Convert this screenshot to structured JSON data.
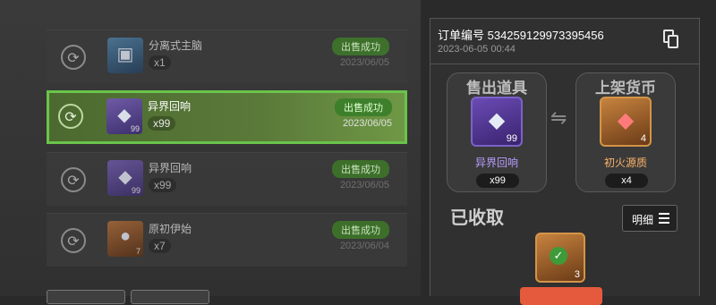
{
  "orders": [
    {
      "name": "分离式主脑",
      "count": "x1",
      "status": "出售成功",
      "date": "2023/06/05",
      "qty": "",
      "icon": "device-icon"
    },
    {
      "name": "异界回响",
      "count": "x99",
      "status": "出售成功",
      "date": "2023/06/05",
      "qty": "99",
      "icon": "crystal-icon"
    },
    {
      "name": "异界回响",
      "count": "x99",
      "status": "出售成功",
      "date": "2023/06/05",
      "qty": "99",
      "icon": "crystal-icon"
    },
    {
      "name": "原初伊始",
      "count": "x7",
      "status": "出售成功",
      "date": "2023/06/04",
      "qty": "7",
      "icon": "planet-icon"
    }
  ],
  "detail": {
    "order_no": "订单编号 534259129973395456",
    "time": "2023-06-05 00:44",
    "sold_title": "售出道具",
    "sold_item": {
      "name": "异界回响",
      "qty": "99",
      "count": "x99"
    },
    "listed_title": "上架货币",
    "listed_item": {
      "name": "初火源质",
      "qty": "4",
      "count": "x4"
    },
    "received_label": "已收取",
    "detail_button": "明细",
    "received_item": {
      "qty": "3"
    }
  }
}
